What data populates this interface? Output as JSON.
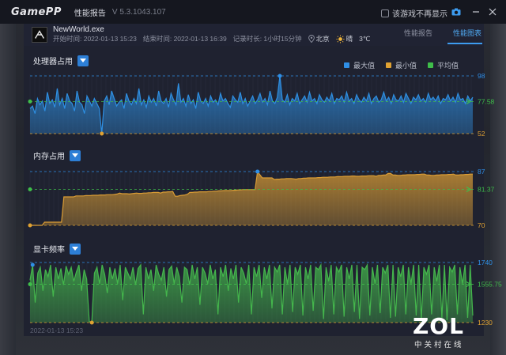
{
  "titlebar": {
    "logo": "GamePP",
    "app_name": "性能报告",
    "version": "V 5.3.1043.107",
    "no_show_label": "该游戏不再显示",
    "icons": [
      "camera-icon",
      "minimize-icon",
      "close-icon"
    ]
  },
  "game": {
    "name": "NewWorld.exe",
    "start": "开始时间: 2022-01-13 15:23",
    "end": "结束时间: 2022-01-13 16:39",
    "duration": "记录时长: 1小时15分钟",
    "city": "北京",
    "weather": "晴",
    "temp": "3℃"
  },
  "tabs": [
    {
      "label": "性能报告",
      "active": false
    },
    {
      "label": "性能图表",
      "active": true
    }
  ],
  "legend": {
    "max": "最大值",
    "min": "最小值",
    "avg": "平均值",
    "colors": {
      "max": "#2f8fe6",
      "min": "#e0a232",
      "avg": "#3fbe4a"
    }
  },
  "charts": [
    {
      "title": "处理器占用",
      "max_label": "98",
      "avg_label": "77.58",
      "min_label": "52",
      "color": "#2e8fe2",
      "chart_data": {
        "type": "area",
        "max": 98,
        "avg": 77.58,
        "min": 52,
        "values": [
          72,
          74,
          68,
          80,
          75,
          78,
          70,
          85,
          76,
          79,
          73,
          88,
          75,
          80,
          72,
          84,
          78,
          76,
          70,
          86,
          77,
          75,
          68,
          82,
          78,
          74,
          80,
          76,
          72,
          52,
          78,
          82,
          75,
          86,
          80,
          74,
          77,
          79,
          72,
          84,
          78,
          75,
          80,
          76,
          88,
          75,
          79,
          73,
          82,
          77,
          80,
          74,
          86,
          78,
          76,
          80,
          73,
          84,
          79,
          75,
          92,
          77,
          80,
          74,
          83,
          76,
          79,
          72,
          85,
          78,
          76,
          80,
          74,
          82,
          77,
          79,
          75,
          84,
          78,
          80,
          76,
          73,
          82,
          79,
          77,
          85,
          76,
          80,
          74,
          78,
          82,
          76,
          79,
          84,
          77,
          80,
          75,
          86,
          78,
          76,
          81,
          98,
          79,
          77,
          83,
          75,
          80,
          78,
          84,
          76,
          79,
          82,
          77,
          85,
          78,
          80,
          76,
          83,
          79,
          77,
          81,
          78,
          84,
          76,
          80,
          79,
          82,
          77,
          85,
          78,
          80,
          76,
          83,
          79,
          77,
          81,
          78,
          84,
          76,
          80,
          82,
          77,
          79,
          85,
          78,
          81,
          76,
          83,
          79,
          78,
          82,
          77,
          84,
          80,
          76,
          81,
          79,
          83,
          78,
          80,
          77,
          84,
          79,
          81,
          78,
          82,
          76,
          80,
          79,
          83,
          78,
          81,
          77,
          84,
          79,
          80,
          76,
          82,
          78,
          81
        ]
      }
    },
    {
      "title": "内存占用",
      "max_label": "87",
      "avg_label": "81.37",
      "min_label": "70",
      "color": "#d99c34",
      "chart_data": {
        "type": "area",
        "max": 87,
        "avg": 81.37,
        "min": 70,
        "values": [
          70,
          70,
          70,
          70,
          70,
          70,
          71,
          71,
          71,
          71,
          71,
          71,
          71,
          71,
          79,
          79,
          79,
          79,
          79,
          79.3,
          79.3,
          79.3,
          79.3,
          79.4,
          79.4,
          79.4,
          79.5,
          79.5,
          79.5,
          79.6,
          79.6,
          79.6,
          79.7,
          79.7,
          79.7,
          79.8,
          79.9,
          80.2,
          80,
          80,
          80,
          79.9,
          80,
          80.1,
          80.2,
          80.1,
          80.1,
          80.2,
          80.2,
          80.3,
          80.3,
          80.4,
          80.4,
          80.4,
          80.2,
          80.5,
          80.5,
          80.6,
          80.6,
          80.7,
          79.2,
          79.2,
          79.4,
          79.5,
          79.6,
          79.8,
          80.4,
          80.4,
          80.5,
          80.5,
          80.6,
          80.6,
          80.6,
          80.6,
          80.7,
          80.7,
          80.8,
          80.8,
          80.9,
          80.9,
          81,
          81,
          81,
          81,
          81.1,
          81.1,
          81.2,
          81.2,
          81.3,
          81.3,
          81.3,
          81.3,
          81.3,
          81.3,
          87,
          86,
          85,
          85,
          85,
          85,
          85,
          84.5,
          84.6,
          84.6,
          84.7,
          84.7,
          84.8,
          84.8,
          84.8,
          84.7,
          84.6,
          84.8,
          84.8,
          84.9,
          84.9,
          85,
          85,
          85,
          85,
          85.1,
          85.1,
          85.2,
          85.2,
          85.2,
          85.3,
          85.3,
          85.3,
          85.4,
          85.4,
          85.4,
          85.5,
          85.5,
          85.5,
          85.6,
          85.6,
          85.5,
          85.5,
          85.6,
          85.6,
          85.6,
          85.7,
          85.7,
          85.7,
          85.5,
          85.8,
          85.8,
          85.9,
          85.9,
          86.4,
          86.4,
          85.9,
          85.9,
          85.8,
          85.8,
          85.9,
          85.9,
          86,
          86,
          86,
          86,
          86.1,
          86.1,
          86.2,
          86.2,
          85.9,
          85.9,
          85.8,
          85.8,
          85.9,
          85.9,
          86,
          86,
          86,
          86.1,
          86.1,
          86.2,
          85.9,
          85.9,
          86,
          86,
          86.1,
          86.1,
          86.2,
          86.2
        ]
      }
    },
    {
      "title": "显卡频率",
      "max_label": "1740",
      "avg_label": "1555.75",
      "min_label": "1230",
      "color": "#44b64c",
      "chart_data": {
        "type": "area",
        "max": 1740,
        "avg": 1555.75,
        "min": 1230,
        "values": [
          1590,
          1720,
          1400,
          1650,
          1700,
          1500,
          1680,
          1620,
          1720,
          1450,
          1700,
          1600,
          1690,
          1550,
          1710,
          1640,
          1700,
          1580,
          1660,
          1720,
          1500,
          1680,
          1600,
          1240,
          1230,
          1650,
          1700,
          1560,
          1720,
          1640,
          1480,
          1700,
          1600,
          1690,
          1560,
          1720,
          1420,
          1700,
          1650,
          1600,
          1700,
          1550,
          1690,
          1720,
          1300,
          1700,
          1600,
          1680,
          1500,
          1720,
          1640,
          1590,
          1700,
          1450,
          1680,
          1710,
          1560,
          1700,
          1620,
          1400,
          1700,
          1680,
          1550,
          1720,
          1600,
          1700,
          1380,
          1700,
          1650,
          1560,
          1720,
          1600,
          1680,
          1300,
          1700,
          1620,
          1720,
          1500,
          1690,
          1600,
          1720,
          1400,
          1700,
          1650,
          1560,
          1720,
          1300,
          1700,
          1620,
          1720,
          1440,
          1700,
          1600,
          1720,
          1350,
          1700,
          1660,
          1720,
          1300,
          1700,
          1560,
          1720,
          1320,
          1700,
          1640,
          1720,
          1290,
          1700,
          1600,
          1720,
          1330,
          1700,
          1680,
          1720,
          1260,
          1700,
          1580,
          1720,
          1300,
          1700,
          1660,
          1720,
          1280,
          1700,
          1600,
          1720,
          1320,
          1720,
          1260,
          1700,
          1680,
          1720,
          1290,
          1700,
          1560,
          1720,
          1310,
          1700,
          1650,
          1720,
          1270,
          1720,
          1280,
          1700,
          1620,
          1720,
          1300,
          1700,
          1560,
          1720,
          1290,
          1720,
          1260,
          1700,
          1640,
          1720,
          1300,
          1700,
          1580,
          1720,
          1270,
          1720,
          1250,
          1700,
          1660,
          1720,
          1300,
          1700,
          1560,
          1720,
          1270,
          1720,
          1290
        ]
      }
    }
  ],
  "footer_time": "2022-01-13 15:23",
  "watermark": {
    "logo": "ZOL",
    "sub": "中关村在线"
  }
}
